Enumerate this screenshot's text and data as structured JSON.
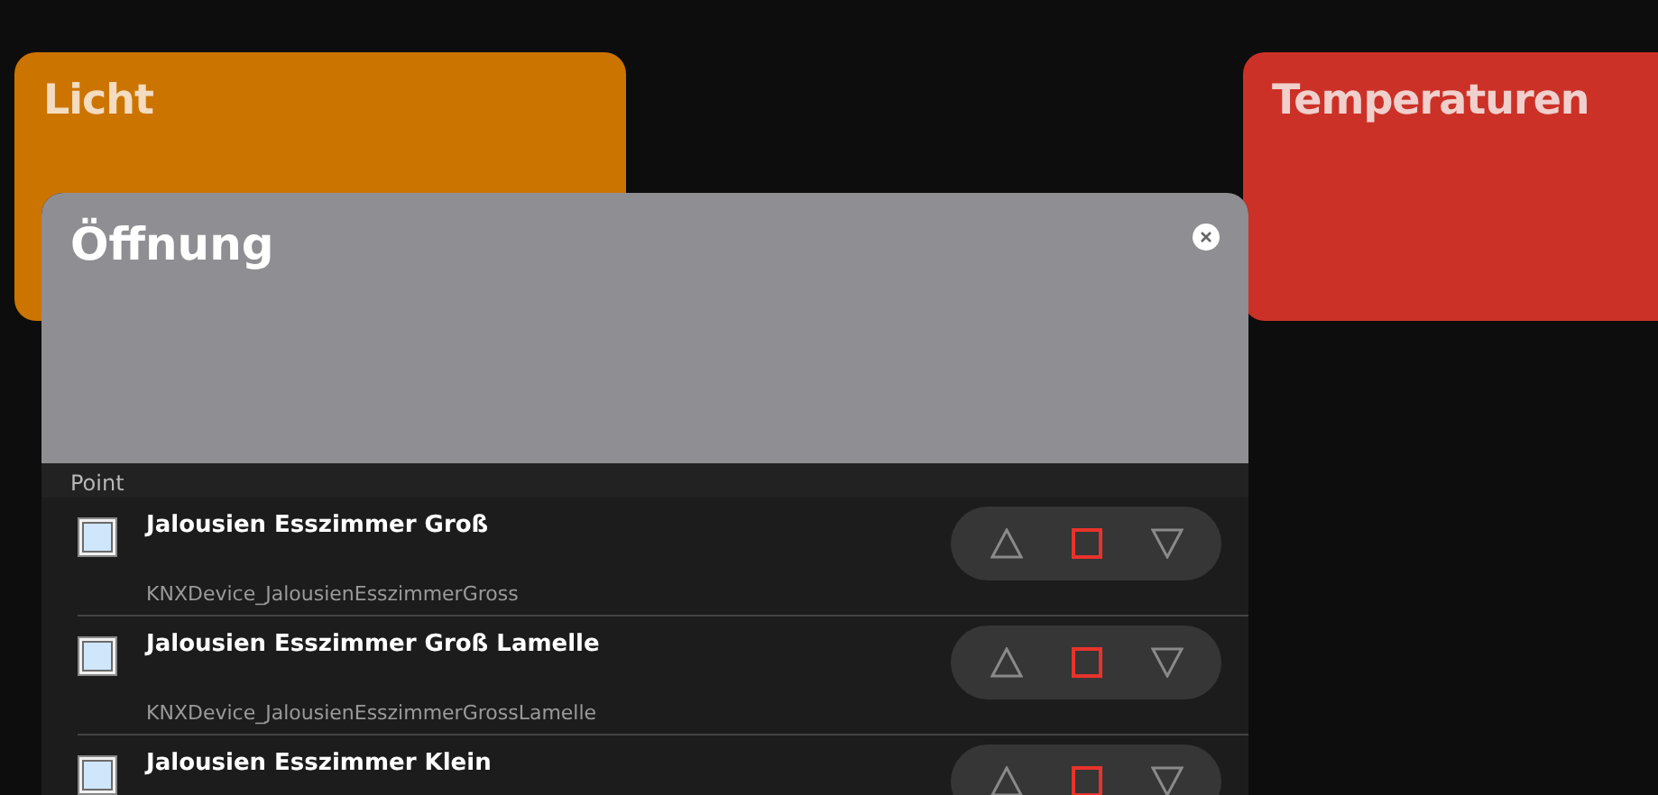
{
  "tiles": [
    {
      "title": "Licht",
      "color": "#cc7400"
    },
    {
      "title": "Temperaturen",
      "color": "#cc3127"
    }
  ],
  "dialog": {
    "title": "Öffnung",
    "column_header": "Point",
    "rows": [
      {
        "name": "Jalousien Esszimmer Groß",
        "device": "KNXDevice_JalousienEsszimmerGross"
      },
      {
        "name": "Jalousien Esszimmer Groß Lamelle",
        "device": "KNXDevice_JalousienEsszimmerGrossLamelle"
      },
      {
        "name": "Jalousien Esszimmer Klein"
      }
    ]
  }
}
